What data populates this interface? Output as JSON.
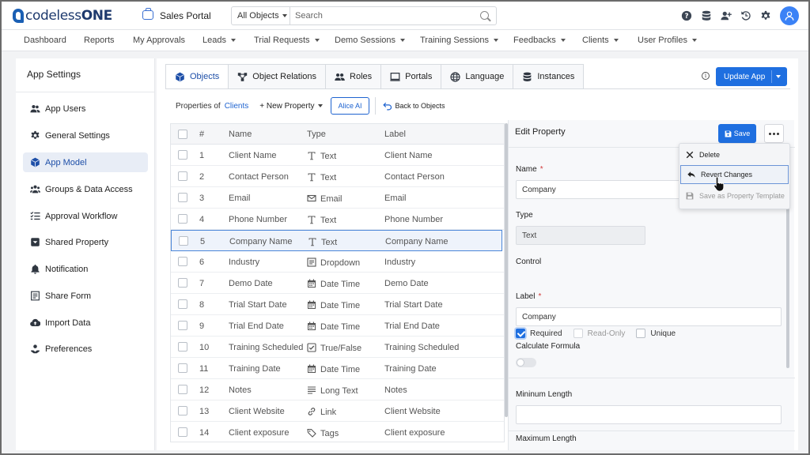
{
  "topbar": {
    "logo_prefix": "codeless",
    "logo_suffix": "ONE",
    "app_name": "Sales Portal",
    "search_scope": "All Objects",
    "search_placeholder": "Search",
    "icons": [
      "help-icon",
      "database-icon",
      "add-user-icon",
      "history-icon",
      "gear-icon",
      "user-avatar-icon"
    ]
  },
  "nav": {
    "items": [
      {
        "label": "Dashboard",
        "dropdown": false
      },
      {
        "label": "Reports",
        "dropdown": false
      },
      {
        "label": "My Approvals",
        "dropdown": false
      },
      {
        "label": "Leads",
        "dropdown": true
      },
      {
        "label": "Trial Requests",
        "dropdown": true
      },
      {
        "label": "Demo Sessions",
        "dropdown": true
      },
      {
        "label": "Training Sessions",
        "dropdown": true
      },
      {
        "label": "Feedbacks",
        "dropdown": true
      },
      {
        "label": "Clients",
        "dropdown": true
      },
      {
        "label": "User Profiles",
        "dropdown": true
      }
    ]
  },
  "sidebar": {
    "title": "App Settings",
    "items": [
      {
        "label": "App Users",
        "icon": "users-icon"
      },
      {
        "label": "General Settings",
        "icon": "gear-icon"
      },
      {
        "label": "App Model",
        "icon": "cube-icon",
        "active": true
      },
      {
        "label": "Groups & Data Access",
        "icon": "group-icon"
      },
      {
        "label": "Approval Workflow",
        "icon": "checklist-icon"
      },
      {
        "label": "Shared Property",
        "icon": "shared-box-icon"
      },
      {
        "label": "Notification",
        "icon": "bell-icon"
      },
      {
        "label": "Share Form",
        "icon": "form-icon"
      },
      {
        "label": "Import Data",
        "icon": "cloud-upload-icon"
      },
      {
        "label": "Preferences",
        "icon": "preferences-icon"
      }
    ]
  },
  "tabs": [
    {
      "label": "Objects",
      "icon": "cube-icon",
      "active": true
    },
    {
      "label": "Object Relations",
      "icon": "relations-icon"
    },
    {
      "label": "Roles",
      "icon": "roles-icon"
    },
    {
      "label": "Portals",
      "icon": "monitor-icon"
    },
    {
      "label": "Language",
      "icon": "globe-icon"
    },
    {
      "label": "Instances",
      "icon": "database-icon"
    }
  ],
  "actions": {
    "update_app": "Update App"
  },
  "subbar": {
    "properties_of": "Properties of",
    "object_name": "Clients",
    "new_property": "+ New Property",
    "alice_ai": "Alice AI",
    "back_to_objects": "Back to Objects"
  },
  "table": {
    "headers": {
      "index": "#",
      "name": "Name",
      "type": "Type",
      "label": "Label"
    },
    "rows": [
      {
        "num": "1",
        "name": "Client Name",
        "type": "Text",
        "icon": "text-type-icon",
        "label": "Client Name"
      },
      {
        "num": "2",
        "name": "Contact Person",
        "type": "Text",
        "icon": "text-type-icon",
        "label": "Contact Person"
      },
      {
        "num": "3",
        "name": "Email",
        "type": "Email",
        "icon": "email-type-icon",
        "label": "Email"
      },
      {
        "num": "4",
        "name": "Phone Number",
        "type": "Text",
        "icon": "text-type-icon",
        "label": "Phone Number"
      },
      {
        "num": "5",
        "name": "Company Name",
        "type": "Text",
        "icon": "text-type-icon",
        "label": "Company Name",
        "selected": true
      },
      {
        "num": "6",
        "name": "Industry",
        "type": "Dropdown",
        "icon": "dropdown-type-icon",
        "label": "Industry"
      },
      {
        "num": "7",
        "name": "Demo Date",
        "type": "Date Time",
        "icon": "calendar-type-icon",
        "label": "Demo Date"
      },
      {
        "num": "8",
        "name": "Trial Start Date",
        "type": "Date Time",
        "icon": "calendar-type-icon",
        "label": "Trial Start Date"
      },
      {
        "num": "9",
        "name": "Trial End Date",
        "type": "Date Time",
        "icon": "calendar-type-icon",
        "label": "Trial End Date"
      },
      {
        "num": "10",
        "name": "Training Scheduled",
        "type": "True/False",
        "icon": "boolean-type-icon",
        "label": "Training Scheduled"
      },
      {
        "num": "11",
        "name": "Training Date",
        "type": "Date Time",
        "icon": "calendar-type-icon",
        "label": "Training Date"
      },
      {
        "num": "12",
        "name": "Notes",
        "type": "Long Text",
        "icon": "longtext-type-icon",
        "label": "Notes"
      },
      {
        "num": "13",
        "name": "Client Website",
        "type": "Link",
        "icon": "link-type-icon",
        "label": "Client Website"
      },
      {
        "num": "14",
        "name": "Client exposure",
        "type": "Tags",
        "icon": "tag-type-icon",
        "label": "Client exposure"
      }
    ]
  },
  "edit": {
    "title": "Edit Property",
    "save": "Save",
    "name_label": "Name",
    "name_value": "Company",
    "type_label": "Type",
    "type_value": "Text",
    "control_label": "Control",
    "control_options": [
      {
        "label": "Required",
        "checked": true
      },
      {
        "label": "Read-Only",
        "checked": false,
        "disabled": true
      },
      {
        "label": "Unique",
        "checked": false
      }
    ],
    "label_label": "Label",
    "label_value": "Company",
    "formula_label": "Calculate Formula",
    "formula_enabled": false,
    "min_length_label": "Mininum Length",
    "min_length_value": "",
    "max_length_label": "Maximum Length",
    "required_mark": "*"
  },
  "menu": {
    "items": [
      {
        "label": "Delete",
        "icon": "close-icon"
      },
      {
        "label": "Revert Changes",
        "icon": "revert-icon",
        "hover": true
      },
      {
        "label": "Save as Property Template",
        "icon": "template-save-icon",
        "disabled": true
      }
    ]
  },
  "colors": {
    "primary": "#1f6fe0",
    "link": "#1e63d0",
    "active_bg": "#e8edf6",
    "required": "#d23b3b"
  }
}
